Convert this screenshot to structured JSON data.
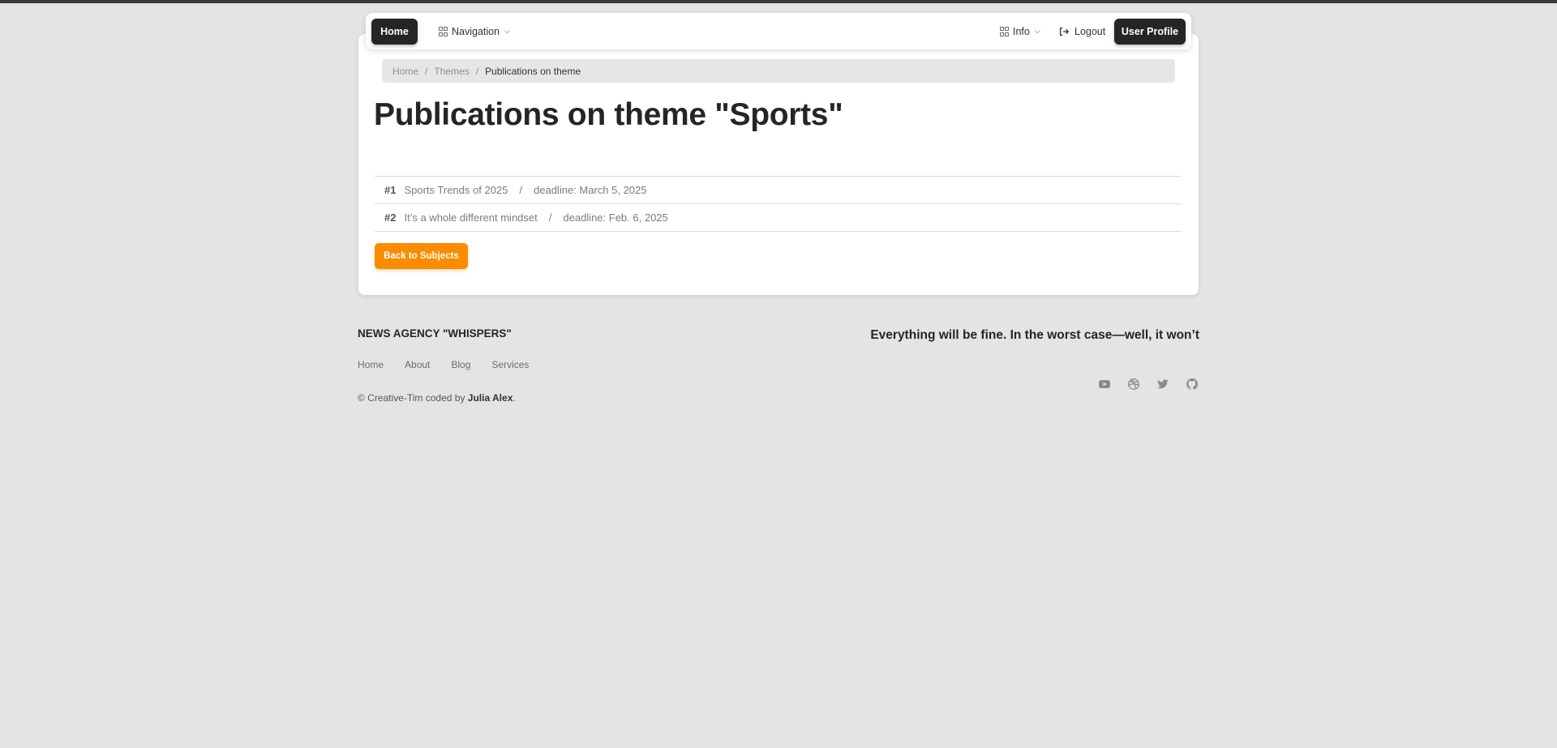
{
  "navbar": {
    "home_label": "Home",
    "navigation_label": "Navigation",
    "info_label": "Info",
    "logout_label": "Logout",
    "profile_label": "User Profile"
  },
  "breadcrumb": {
    "items": [
      "Home",
      "Themes",
      "Publications on theme"
    ],
    "separator": "/"
  },
  "page": {
    "title": "Publications on theme \"Sports\""
  },
  "publications": [
    {
      "num": "#1",
      "title": "Sports Trends of 2025",
      "separator": "/",
      "deadline": "deadline: March 5, 2025"
    },
    {
      "num": "#2",
      "title": "It’s a whole different mindset",
      "separator": "/",
      "deadline": "deadline: Feb. 6, 2025"
    }
  ],
  "back_button_label": "Back to Subjects",
  "footer": {
    "brand": "NEWS AGENCY \"WHISPERS\"",
    "links": [
      "Home",
      "About",
      "Blog",
      "Services"
    ],
    "copyright_prefix": "© Creative-Tim coded by ",
    "copyright_author": "Julia Alex",
    "copyright_suffix": ".",
    "quote": "Everything will be fine. In the worst case—well, it won’t",
    "social": [
      "youtube-icon",
      "dribbble-icon",
      "twitter-icon",
      "github-icon"
    ]
  },
  "colors": {
    "accent": "#fb8c00",
    "dark_button": "#252525",
    "background": "#e4e4e4"
  }
}
